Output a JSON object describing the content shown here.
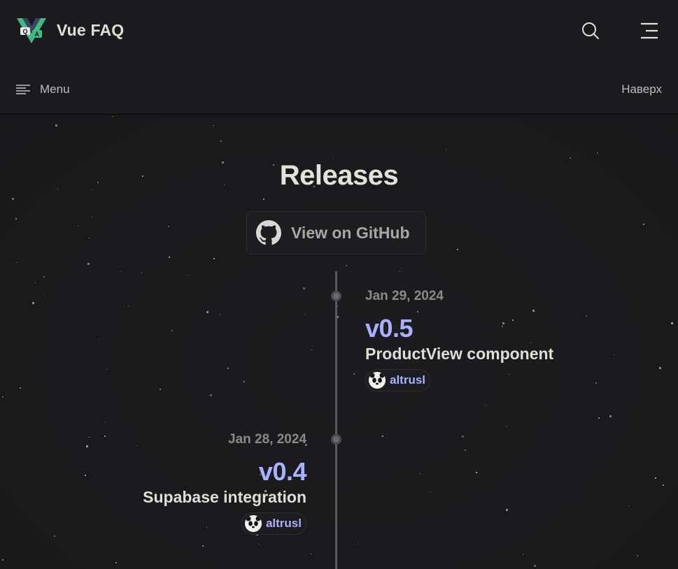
{
  "header": {
    "site_title": "Vue FAQ",
    "logo_icon": "vue-qa-logo-icon",
    "search_icon": "search-icon",
    "burger_icon": "hamburger-icon"
  },
  "subnav": {
    "menu_label": "Menu",
    "menu_icon": "menu-lines-icon",
    "top_link_label": "Наверх"
  },
  "page": {
    "title": "Releases",
    "github_button_label": "View on GitHub",
    "github_icon": "github-icon"
  },
  "releases": [
    {
      "date": "Jan 29, 2024",
      "version": "v0.5",
      "title": "ProductView component",
      "author": "altrusl",
      "side": "right"
    },
    {
      "date": "Jan 28, 2024",
      "version": "v0.4",
      "title": "Supabase integration",
      "author": "altrusl",
      "side": "left"
    }
  ],
  "colors": {
    "background": "#1b1b1f",
    "accent": "#a8b1ff",
    "text": "#dfdfd6",
    "muted": "#8a8a86"
  }
}
